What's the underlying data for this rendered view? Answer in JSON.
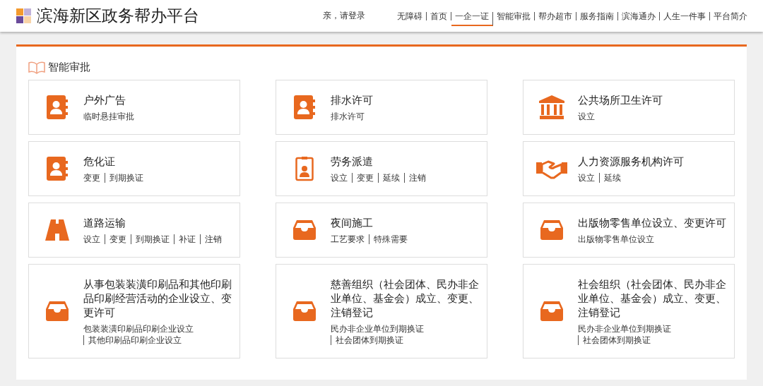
{
  "header": {
    "title": "滨海新区政务帮办平台",
    "login": "亲，请登录",
    "nav": [
      {
        "label": "无障碍",
        "selected": false
      },
      {
        "label": "首页",
        "selected": false
      },
      {
        "label": "一企一证",
        "selected": true
      },
      {
        "label": "智能审批",
        "selected": false
      },
      {
        "label": "帮办超市",
        "selected": false
      },
      {
        "label": "服务指南",
        "selected": false
      },
      {
        "label": "滨海通办",
        "selected": false
      },
      {
        "label": "人生一件事",
        "selected": false
      },
      {
        "label": "平台简介",
        "selected": false
      }
    ]
  },
  "section": {
    "title": "智能审批",
    "cards": [
      {
        "kind": "contacts",
        "title": "户外广告",
        "links": [
          "临时悬挂审批"
        ]
      },
      {
        "kind": "contacts",
        "title": "排水许可",
        "links": [
          "排水许可"
        ]
      },
      {
        "kind": "bank",
        "title": "公共场所卫生许可",
        "links": [
          "设立"
        ]
      },
      {
        "kind": "contacts",
        "title": "危化证",
        "links": [
          "变更",
          "到期换证"
        ]
      },
      {
        "kind": "badge",
        "title": "劳务派遣",
        "links": [
          "设立",
          "变更",
          "延续",
          "注销"
        ]
      },
      {
        "kind": "handshake",
        "title": "人力资源服务机构许可",
        "links": [
          "设立",
          "延续"
        ]
      },
      {
        "kind": "road",
        "title": "道路运输",
        "links": [
          "设立",
          "变更",
          "到期换证",
          "补证",
          "注销"
        ]
      },
      {
        "kind": "tray",
        "title": "夜间施工",
        "links": [
          "工艺要求",
          "特殊需要"
        ]
      },
      {
        "kind": "tray",
        "title": "出版物零售单位设立、变更许可",
        "links": [
          "出版物零售单位设立"
        ]
      },
      {
        "kind": "tray",
        "title": "从事包装装潢印刷品和其他印刷品印刷经营活动的企业设立、变更许可",
        "links": [
          "包装装潢印刷品印刷企业设立",
          "其他印刷品印刷企业设立"
        ]
      },
      {
        "kind": "tray",
        "title": "慈善组织（社会团体、民办非企业单位、基金会）成立、变更、注销登记",
        "links": [
          "民办非企业单位到期换证",
          "社会团体到期换证"
        ]
      },
      {
        "kind": "tray",
        "title": "社会组织（社会团体、民办非企业单位、基金会）成立、变更、注销登记",
        "links": [
          "民办非企业单位到期换证",
          "社会团体到期换证"
        ]
      }
    ]
  }
}
